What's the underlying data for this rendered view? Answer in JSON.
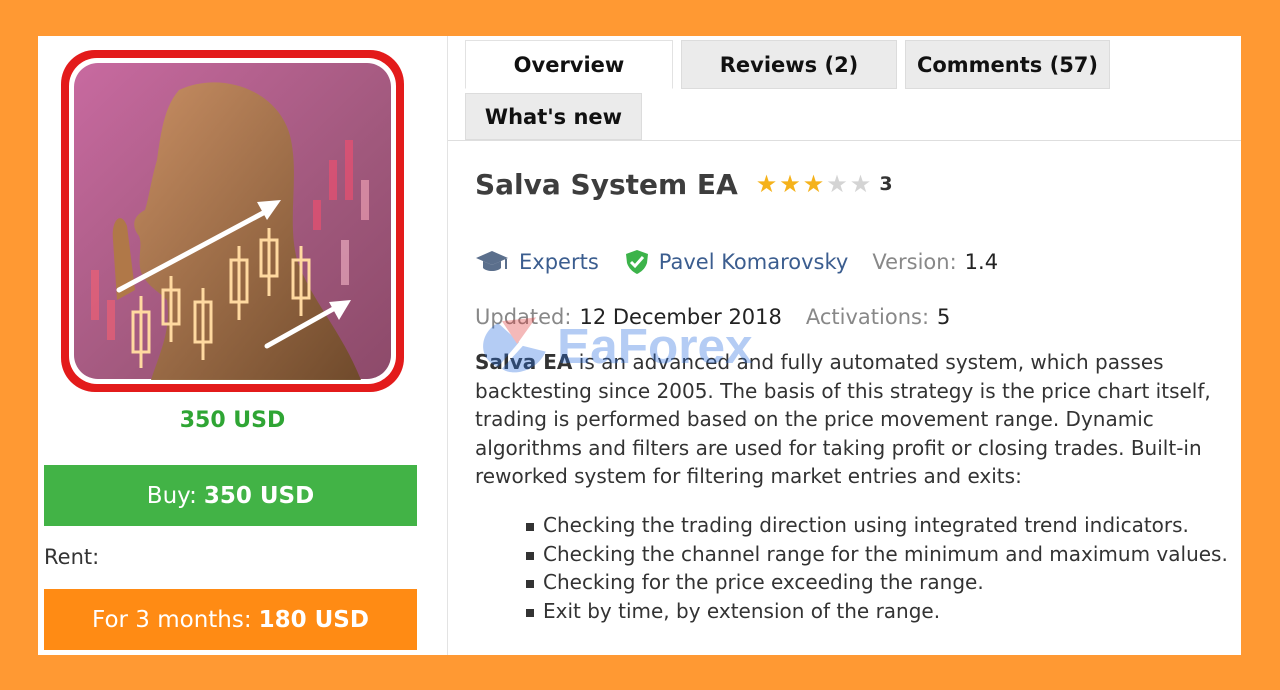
{
  "product": {
    "price_label": "350 USD",
    "buy_prefix": "Buy:",
    "buy_amount": "350 USD",
    "rent_label": "Rent:",
    "rent_prefix": "For 3 months:",
    "rent_amount": "180 USD"
  },
  "tabs": [
    {
      "label": "Overview",
      "active": true
    },
    {
      "label": "Reviews (2)",
      "active": false
    },
    {
      "label": "Comments (57)",
      "active": false
    },
    {
      "label": "What's new",
      "active": false
    }
  ],
  "header": {
    "title": "Salva System EA",
    "rating": 3,
    "rating_max": 5,
    "rating_count": "3"
  },
  "meta": {
    "category": "Experts",
    "author": "Pavel Komarovsky",
    "version_label": "Version:",
    "version_value": "1.4",
    "icons": [
      "graduation-cap-icon",
      "verified-shield-icon"
    ]
  },
  "info": {
    "updated_label": "Updated:",
    "updated_value": "12 December 2018",
    "activations_label": "Activations:",
    "activations_value": "5"
  },
  "description": {
    "name": "Salva EA",
    "text": " is an advanced and fully automated system, which passes backtesting since 2005. The basis of this strategy is the price chart itself, trading is performed based on the price movement range. Dynamic algorithms and filters are used for taking profit or closing trades. Built-in reworked system for filtering market entries and exits:"
  },
  "features": [
    "Checking the trading direction using integrated trend indicators.",
    "Checking the channel range for the minimum and maximum values.",
    "Checking for the price exceeding the range.",
    "Exit by time, by extension of the range."
  ],
  "watermark": "EaForex",
  "colors": {
    "background": "#ff9933",
    "buy_button": "#42b346",
    "rent_button": "#ff8b14",
    "price": "#2fa534",
    "link": "#3b5d8f",
    "star_on": "#f5b21b",
    "star_off": "#d4d4d4"
  }
}
